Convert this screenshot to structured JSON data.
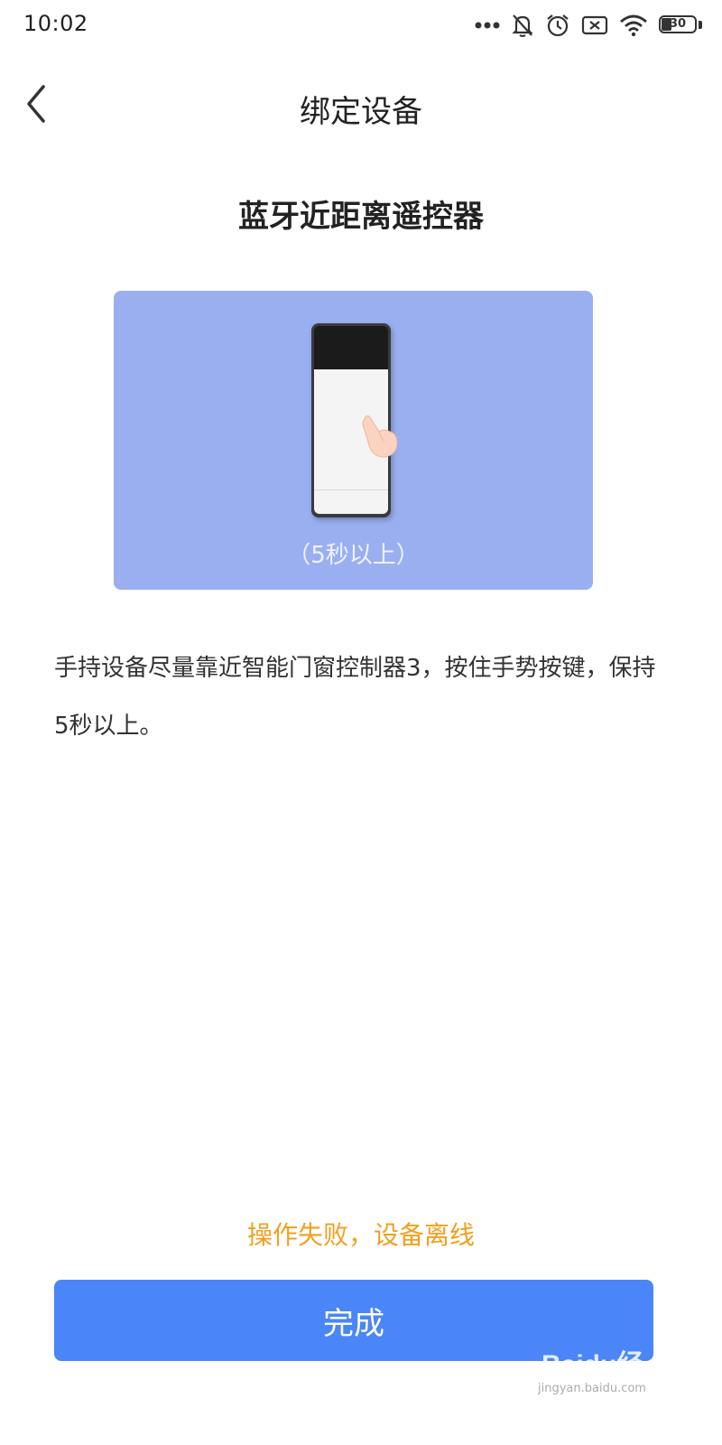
{
  "status_bar": {
    "time": "10:02",
    "icons": [
      "more-dots-icon",
      "mute-bell-icon",
      "alarm-icon",
      "sim-off-icon",
      "wifi-icon",
      "battery-icon"
    ],
    "battery_percent": "30",
    "battery_level": 0.3
  },
  "header": {
    "title": "绑定设备",
    "back_icon": "chevron-left-icon"
  },
  "device": {
    "name": "蓝牙近距离遥控器"
  },
  "illustration": {
    "background_color": "#9aaff0",
    "duration_label": "（5秒以上）"
  },
  "instruction": {
    "text": "手持设备尽量靠近智能门窗控制器3，按住手势按键，保持5秒以上。"
  },
  "status_message": {
    "text": "操作失败，设备离线",
    "color": "#f0a020"
  },
  "actions": {
    "done_label": "完成",
    "done_color": "#4a86f7"
  },
  "watermark": {
    "brand": "Baidu经验",
    "url": "jingyan.baidu.com"
  }
}
